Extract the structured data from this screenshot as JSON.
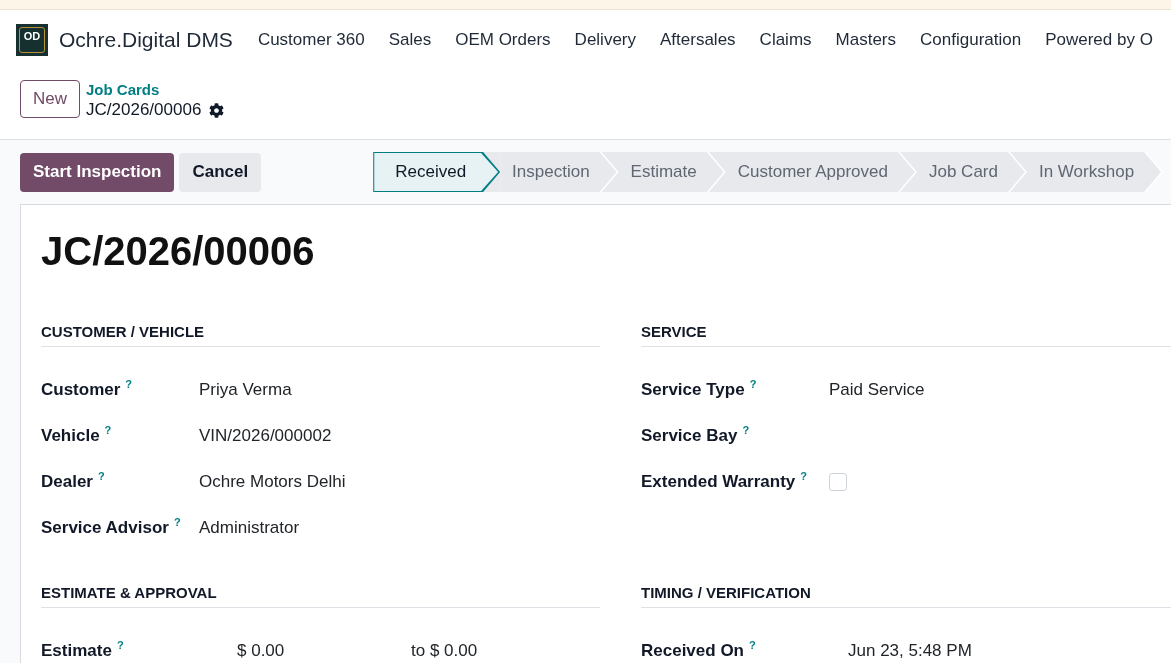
{
  "top_bar": {
    "logo": "OD",
    "app_name": "Ochre.Digital DMS",
    "menu": [
      "Customer 360",
      "Sales",
      "OEM Orders",
      "Delivery",
      "Aftersales",
      "Claims",
      "Masters",
      "Configuration",
      "Powered by O"
    ]
  },
  "control_panel": {
    "new_button": "New",
    "breadcrumb": {
      "parent": "Job Cards",
      "current": "JC/2026/00006"
    }
  },
  "actions": [
    {
      "label": "Start Inspection",
      "kind": "primary"
    },
    {
      "label": "Cancel",
      "kind": "secondary"
    }
  ],
  "stages": [
    {
      "label": "Received",
      "selected": true
    },
    {
      "label": "Inspection",
      "selected": false
    },
    {
      "label": "Estimate",
      "selected": false
    },
    {
      "label": "Customer Approved",
      "selected": false
    },
    {
      "label": "Job Card",
      "selected": false
    },
    {
      "label": "In Workshop",
      "selected": false
    }
  ],
  "form": {
    "title": "JC/2026/00006",
    "sections": [
      {
        "heading": "CUSTOMER / VEHICLE",
        "fields": [
          {
            "kind": "text",
            "label": "Customer",
            "help": "?",
            "value": "Priya Verma"
          },
          {
            "kind": "text",
            "label": "Vehicle",
            "help": "?",
            "value": "VIN/2026/000002"
          },
          {
            "kind": "text",
            "label": "Dealer",
            "help": "?",
            "value": "Ochre Motors Delhi"
          },
          {
            "kind": "text",
            "label": "Service Advisor",
            "help": "?",
            "value": "Administrator"
          }
        ]
      },
      {
        "heading": "SERVICE",
        "fields": [
          {
            "kind": "text",
            "label": "Service Type",
            "help": "?",
            "value": "Paid Service"
          },
          {
            "kind": "text",
            "label": "Service Bay",
            "help": "?"
          },
          {
            "kind": "checkbox",
            "label": "Extended Warranty",
            "help": "?",
            "checked": false
          }
        ]
      },
      {
        "heading": "ESTIMATE & APPROVAL",
        "fields": [
          {
            "kind": "range",
            "label": "Estimate",
            "help": "?",
            "value": "$ 0.00",
            "value_to": "to $ 0.00"
          }
        ]
      },
      {
        "heading": "TIMING / VERIFICATION",
        "fields": [
          {
            "kind": "text",
            "label": "Received On",
            "help": "?",
            "value": "Jun 23, 5:48 PM"
          }
        ]
      }
    ]
  }
}
